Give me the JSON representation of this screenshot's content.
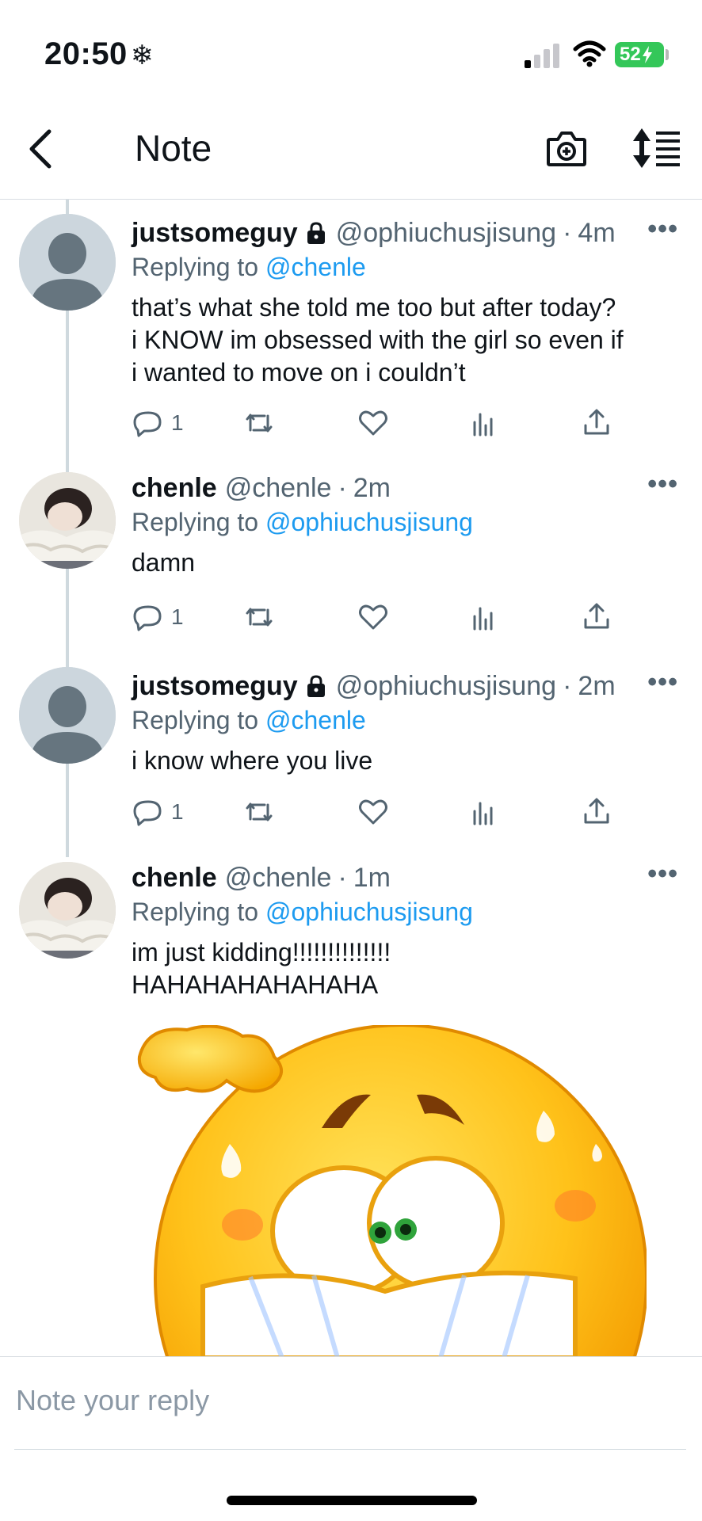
{
  "status_bar": {
    "time": "20:50",
    "glyph": "❄",
    "battery": "52"
  },
  "header": {
    "title": "Note"
  },
  "replies": [
    {
      "display_name": "justsomeguy",
      "handle": "@ophiuchusjisung",
      "time": "4m",
      "replying_prefix": "Replying to",
      "replying_to": "@chenle",
      "text": "that’s what she told me too but after today?\ni KNOW im obsessed with the girl so even if\ni wanted to move on i couldn’t",
      "reply_count": "1"
    },
    {
      "display_name": "chenle",
      "handle": "@chenle",
      "time": "2m",
      "replying_prefix": "Replying to",
      "replying_to": "@ophiuchusjisung",
      "text": "damn",
      "reply_count": "1"
    },
    {
      "display_name": "justsomeguy",
      "handle": "@ophiuchusjisung",
      "time": "2m",
      "replying_prefix": "Replying to",
      "replying_to": "@chenle",
      "text": "i know where you live",
      "reply_count": "1"
    },
    {
      "display_name": "chenle",
      "handle": "@chenle",
      "time": "1m",
      "replying_prefix": "Replying to",
      "replying_to": "@ophiuchusjisung",
      "text": "im just kidding!!!!!!!!!!!!!!\nHAHAHAHAHAHAHA"
    }
  ],
  "more_glyph": "•••",
  "dot": "·",
  "composer": {
    "placeholder": "Note your reply"
  },
  "colors": {
    "accent": "#1d9bf0",
    "muted": "#536471",
    "thread": "#cfd9de",
    "battery": "#34c759"
  }
}
